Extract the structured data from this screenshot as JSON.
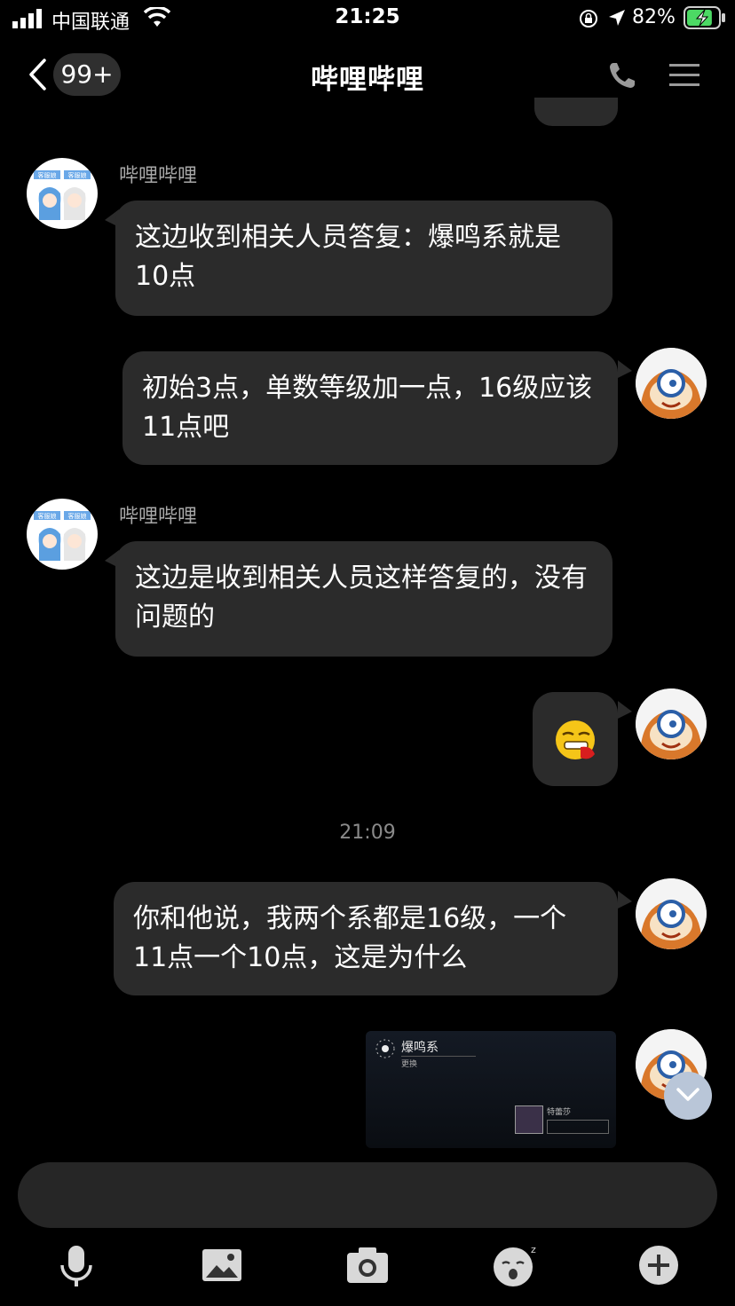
{
  "status_bar": {
    "carrier": "中国联通",
    "time": "21:25",
    "battery_percent": "82%",
    "battery_level": 0.82
  },
  "nav": {
    "unread_badge": "99+",
    "title": "哔哩哔哩",
    "back_icon": "chevron-left-icon",
    "call_icon": "phone-icon",
    "menu_icon": "menu-icon"
  },
  "messages": [
    {
      "from": "service",
      "sender": "哔哩哔哩",
      "text": "这边收到相关人员答复：爆鸣系就是10点"
    },
    {
      "from": "me",
      "text": "初始3点，单数等级加一点，16级应该11点吧"
    },
    {
      "from": "service",
      "sender": "哔哩哔哩",
      "text": "这边是收到相关人员这样答复的，没有问题的"
    },
    {
      "from": "me",
      "type": "emoji",
      "emoji": "vomiting-emoji"
    },
    {
      "from": "me",
      "text": "你和他说，我两个系都是16级，一个11点一个10点，这是为什么"
    },
    {
      "from": "me",
      "type": "image",
      "image_title": "爆鸣系",
      "image_subtitle": "更换",
      "image_label": "特蕾莎"
    }
  ],
  "timestamp": "21:09",
  "avatar_badge_text": "客服娘",
  "input": {
    "placeholder": ""
  },
  "toolbar": {
    "icons": [
      "microphone-icon",
      "image-icon",
      "camera-icon",
      "emoji-icon",
      "plus-icon"
    ]
  },
  "colors": {
    "background": "#000000",
    "bubble": "#2b2b2b",
    "battery": "#4cd964"
  }
}
